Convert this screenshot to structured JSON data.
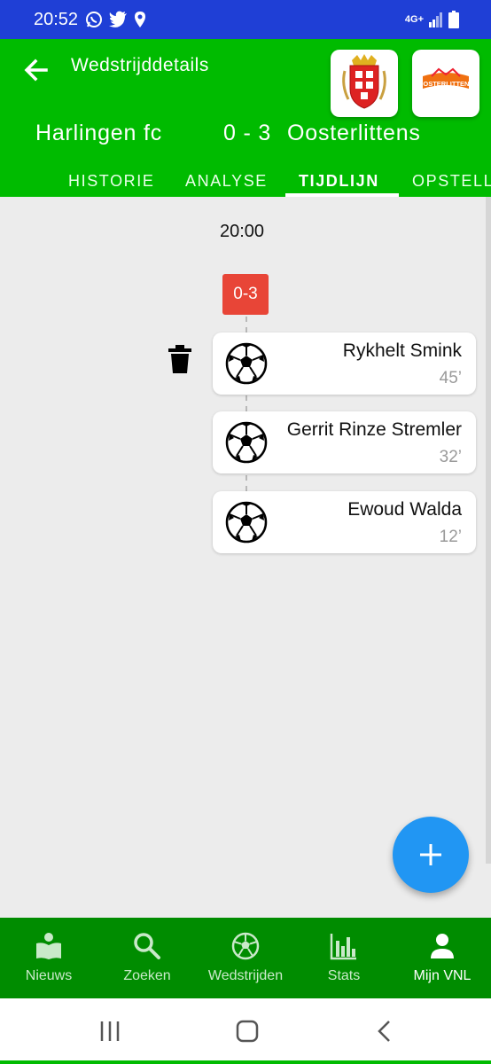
{
  "status_bar": {
    "time": "20:52",
    "network_label": "4G+",
    "left_icons": [
      "whatsapp-icon",
      "twitter-icon",
      "location-icon"
    ],
    "right_icons": [
      "network-icon",
      "signal-icon",
      "battery-icon"
    ]
  },
  "header": {
    "title": "Wedstrijddetails",
    "home_team": "Harlingen fc",
    "score": "0 - 3",
    "away_team": "Oosterlittens",
    "away_logo_text": "OOSTERLITTENS",
    "tabs": [
      {
        "label": "HISTORIE",
        "active": false
      },
      {
        "label": "ANALYSE",
        "active": false
      },
      {
        "label": "TIJDLIJN",
        "active": true
      },
      {
        "label": "OPSTELL",
        "active": false
      }
    ]
  },
  "timeline": {
    "kick_off_time": "20:00",
    "score_badge": "0-3",
    "events": [
      {
        "player": "Rykhelt Smink",
        "minute": "45’",
        "icon": "soccer-ball-icon"
      },
      {
        "player": "Gerrit Rinze Stremler",
        "minute": "32’",
        "icon": "soccer-ball-icon"
      },
      {
        "player": "Ewoud Walda",
        "minute": "12’",
        "icon": "soccer-ball-icon"
      }
    ]
  },
  "fab": {
    "icon": "plus-icon"
  },
  "bottom_nav": {
    "items": [
      {
        "label": "Nieuws",
        "icon": "news-icon",
        "active": false
      },
      {
        "label": "Zoeken",
        "icon": "search-icon",
        "active": false
      },
      {
        "label": "Wedstrijden",
        "icon": "soccer-ball-icon",
        "active": false
      },
      {
        "label": "Stats",
        "icon": "bar-chart-icon",
        "active": false
      },
      {
        "label": "Mijn VNL",
        "icon": "person-icon",
        "active": true
      }
    ]
  },
  "colors": {
    "status_bar": "#1f3fd6",
    "header_green": "#00bb00",
    "nav_green": "#008c00",
    "score_badge": "#e84537",
    "fab_blue": "#2196f3"
  }
}
